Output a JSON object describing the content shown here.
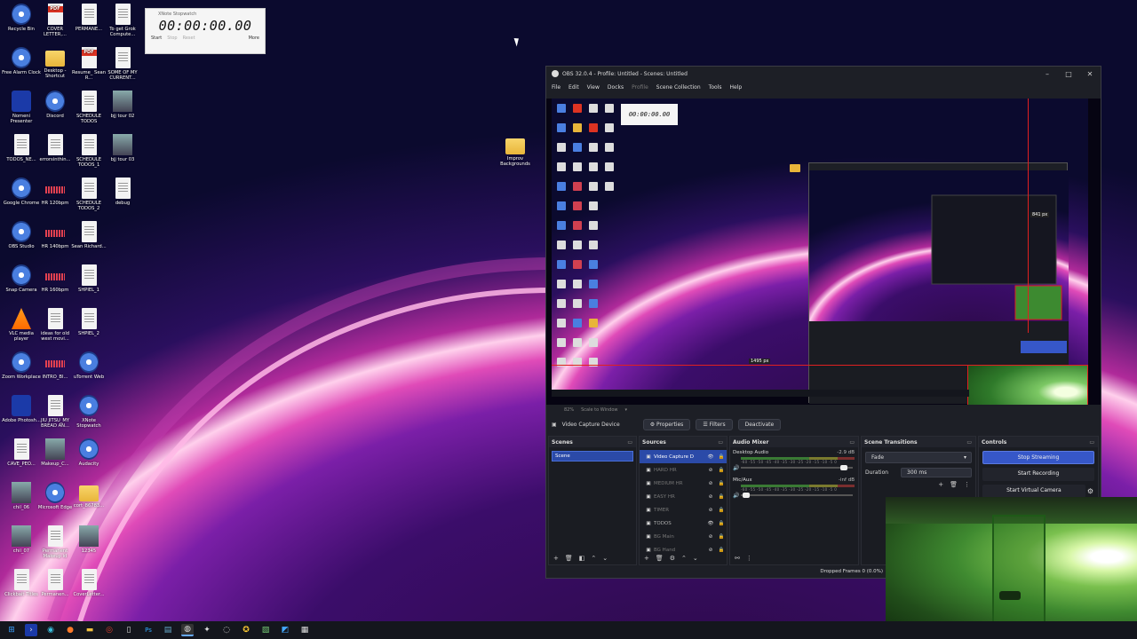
{
  "desktop": {
    "icons": [
      {
        "label": "Recycle Bin",
        "icon": "recycle-bin-icon",
        "kind": "round"
      },
      {
        "label": "COVER LETTER,...",
        "icon": "pdf-icon",
        "kind": "pdf"
      },
      {
        "label": "PERMANE...",
        "icon": "document-icon",
        "kind": "doc"
      },
      {
        "label": "To get Grok Compute...",
        "icon": "document-icon",
        "kind": "doc"
      },
      {
        "label": "Free Alarm Clock",
        "icon": "alarm-clock-icon",
        "kind": "round"
      },
      {
        "label": "Desktop - Shortcut",
        "icon": "folder-icon",
        "kind": "folder"
      },
      {
        "label": "Resume_ Sean R...",
        "icon": "pdf-icon",
        "kind": "pdf"
      },
      {
        "label": "SOME OF MY CURRENT...",
        "icon": "document-icon",
        "kind": "doc"
      },
      {
        "label": "Nomeni Presenter",
        "icon": "presenter-icon",
        "kind": "text"
      },
      {
        "label": "Discord",
        "icon": "discord-icon",
        "kind": "round"
      },
      {
        "label": "SCHEDULE TODOS",
        "icon": "document-icon",
        "kind": "doc"
      },
      {
        "label": "bjj tour 02",
        "icon": "image-icon",
        "kind": "img"
      },
      {
        "label": "TODOS_NE...",
        "icon": "document-icon",
        "kind": "doc"
      },
      {
        "label": "errorsinthin...",
        "icon": "document-icon",
        "kind": "doc"
      },
      {
        "label": "SCHEDULE TODOS_1",
        "icon": "document-icon",
        "kind": "doc"
      },
      {
        "label": "bjj tour 03",
        "icon": "image-icon",
        "kind": "img"
      },
      {
        "label": "Google Chrome",
        "icon": "chrome-icon",
        "kind": "round"
      },
      {
        "label": "HR 120bpm",
        "icon": "audio-icon",
        "kind": "audio"
      },
      {
        "label": "SCHEDULE TODOS_2",
        "icon": "document-icon",
        "kind": "doc"
      },
      {
        "label": "debug",
        "icon": "document-icon",
        "kind": "doc"
      },
      {
        "label": "OBS Studio",
        "icon": "obs-icon",
        "kind": "round"
      },
      {
        "label": "HR 140bpm",
        "icon": "audio-icon",
        "kind": "audio"
      },
      {
        "label": "Sean Richard...",
        "icon": "document-icon",
        "kind": "doc"
      },
      {
        "label": "",
        "icon": "",
        "kind": "none"
      },
      {
        "label": "Snap Camera",
        "icon": "snap-camera-icon",
        "kind": "round"
      },
      {
        "label": "HR 160bpm",
        "icon": "audio-icon",
        "kind": "audio"
      },
      {
        "label": "SHPIEL_1",
        "icon": "document-icon",
        "kind": "doc"
      },
      {
        "label": "",
        "icon": "",
        "kind": "none"
      },
      {
        "label": "VLC media player",
        "icon": "vlc-icon",
        "kind": "vlc"
      },
      {
        "label": "ideas for old west movi...",
        "icon": "document-icon",
        "kind": "doc"
      },
      {
        "label": "SHPIEL_2",
        "icon": "document-icon",
        "kind": "doc"
      },
      {
        "label": "",
        "icon": "",
        "kind": "none"
      },
      {
        "label": "Zoom Workplace",
        "icon": "zoom-icon",
        "kind": "round"
      },
      {
        "label": "INTRO_BI...",
        "icon": "audio-icon",
        "kind": "audio"
      },
      {
        "label": "uTorrent Web",
        "icon": "utorrent-icon",
        "kind": "round"
      },
      {
        "label": "",
        "icon": "",
        "kind": "none"
      },
      {
        "label": "Adobe Photosh...",
        "icon": "photoshop-icon",
        "kind": "text"
      },
      {
        "label": "JIU JITSU_MY BREAD AN...",
        "icon": "document-icon",
        "kind": "doc"
      },
      {
        "label": "XNote Stopwatch",
        "icon": "stopwatch-icon",
        "kind": "round"
      },
      {
        "label": "",
        "icon": "",
        "kind": "none"
      },
      {
        "label": "CAVE_PEO...",
        "icon": "document-icon",
        "kind": "doc"
      },
      {
        "label": "Makeup_C...",
        "icon": "image-icon",
        "kind": "img"
      },
      {
        "label": "Audacity",
        "icon": "audacity-icon",
        "kind": "round"
      },
      {
        "label": "",
        "icon": "",
        "kind": "none"
      },
      {
        "label": "chil_06",
        "icon": "image-icon",
        "kind": "img"
      },
      {
        "label": "Microsoft Edge",
        "icon": "edge-icon",
        "kind": "round"
      },
      {
        "label": "cort_86783...",
        "icon": "folder-zip-icon",
        "kind": "folder"
      },
      {
        "label": "",
        "icon": "",
        "kind": "none"
      },
      {
        "label": "chil_07",
        "icon": "image-icon",
        "kind": "img"
      },
      {
        "label": "Permanent Makeup id",
        "icon": "document-icon",
        "kind": "doc"
      },
      {
        "label": "12345",
        "icon": "image-icon",
        "kind": "img"
      },
      {
        "label": "",
        "icon": "",
        "kind": "none"
      },
      {
        "label": "Clickbait Titles",
        "icon": "document-icon",
        "kind": "doc"
      },
      {
        "label": "Permanen...",
        "icon": "document-icon",
        "kind": "doc"
      },
      {
        "label": "CoverLetter...",
        "icon": "document-icon",
        "kind": "doc"
      }
    ],
    "improv_folder": "Improv Backgrounds"
  },
  "stopwatch": {
    "title": "XNote Stopwatch",
    "time": "00:00:00.00",
    "buttons": [
      "Start",
      "Stop",
      "Reset",
      "More"
    ]
  },
  "obs": {
    "title": "OBS 32.0.4 - Profile: Untitled - Scenes: Untitled",
    "menu": [
      "File",
      "Edit",
      "View",
      "Docks",
      "Profile",
      "Scene Collection",
      "Tools",
      "Help"
    ],
    "preview": {
      "label_width": "1495 px",
      "label_height": "841 px",
      "scale": "82%",
      "scale_mode": "Scale to Window"
    },
    "source_bar": {
      "source": "Video Capture Device",
      "properties": "Properties",
      "filters": "Filters",
      "deactivate": "Deactivate"
    },
    "scenes": {
      "title": "Scenes",
      "items": [
        "Scene"
      ]
    },
    "sources": {
      "title": "Sources",
      "items": [
        {
          "name": "Video Capture D",
          "visible": true,
          "selected": true
        },
        {
          "name": "HARD HR",
          "visible": false,
          "selected": false
        },
        {
          "name": "MEDIUM HR",
          "visible": false,
          "selected": false
        },
        {
          "name": "EASY HR",
          "visible": false,
          "selected": false
        },
        {
          "name": "TIMER",
          "visible": false,
          "selected": false
        },
        {
          "name": "TODOS",
          "visible": true,
          "selected": false
        },
        {
          "name": "BG Main",
          "visible": false,
          "selected": false
        },
        {
          "name": "BG Hand",
          "visible": false,
          "selected": false
        }
      ]
    },
    "audio_mixer": {
      "title": "Audio Mixer",
      "channels": [
        {
          "name": "Desktop Audio",
          "db": "-2.9 dB",
          "volume": 0.92
        },
        {
          "name": "Mic/Aux",
          "db": "-inf dB",
          "volume": 0.05
        }
      ],
      "ticks": "-60 -55 -50 -45 -40 -35 -30 -25 -20 -15 -10 -5 0"
    },
    "transitions": {
      "title": "Scene Transitions",
      "type": "Fade",
      "duration_label": "Duration",
      "duration": "300 ms"
    },
    "controls": {
      "title": "Controls",
      "start_streaming": "Stop Streaming",
      "start_recording": "Start Recording",
      "virtual_camera": "Start Virtual Camera"
    },
    "status": "Dropped Frames 0 (0.0%)"
  },
  "colors": {
    "accent": "#2b4aa8",
    "selection": "#e02020",
    "obs_bg": "#1d1f26"
  }
}
